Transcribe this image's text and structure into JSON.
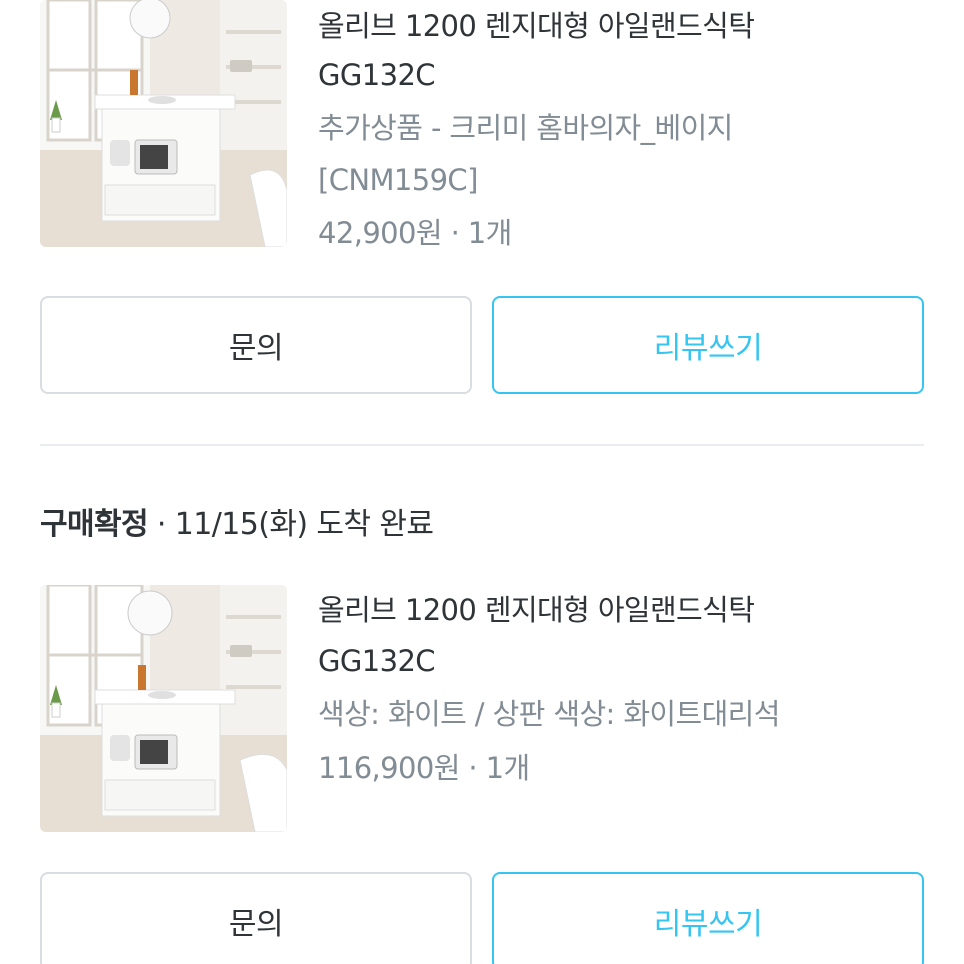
{
  "orders": [
    {
      "product": {
        "image_alt": "kitchen island table product photo",
        "title_line1": "올리브 1200 렌지대형 아일랜드식탁",
        "title_line2": "GG132C",
        "option_line1": "추가상품 - 크리미 홈바의자_베이지",
        "option_line2": "[CNM159C]",
        "price": "42,900원 · 1개"
      },
      "buttons": {
        "inquiry": "문의",
        "review": "리뷰쓰기"
      }
    },
    {
      "status": {
        "label": "구매확정",
        "detail": " · 11/15(화) 도착 완료"
      },
      "product": {
        "image_alt": "kitchen island table product photo",
        "title_line1": "올리브 1200 렌지대형 아일랜드식탁",
        "title_line2": "GG132C",
        "option_line1": "색상: 화이트 / 상판 색상: 화이트대리석",
        "price": "116,900원 · 1개"
      },
      "buttons": {
        "inquiry": "문의",
        "review": "리뷰쓰기"
      }
    }
  ],
  "colors": {
    "accent": "#35c5f0",
    "text": "#2f3438",
    "muted": "#828c94",
    "border": "#dadde0",
    "divider": "#eaedef"
  }
}
